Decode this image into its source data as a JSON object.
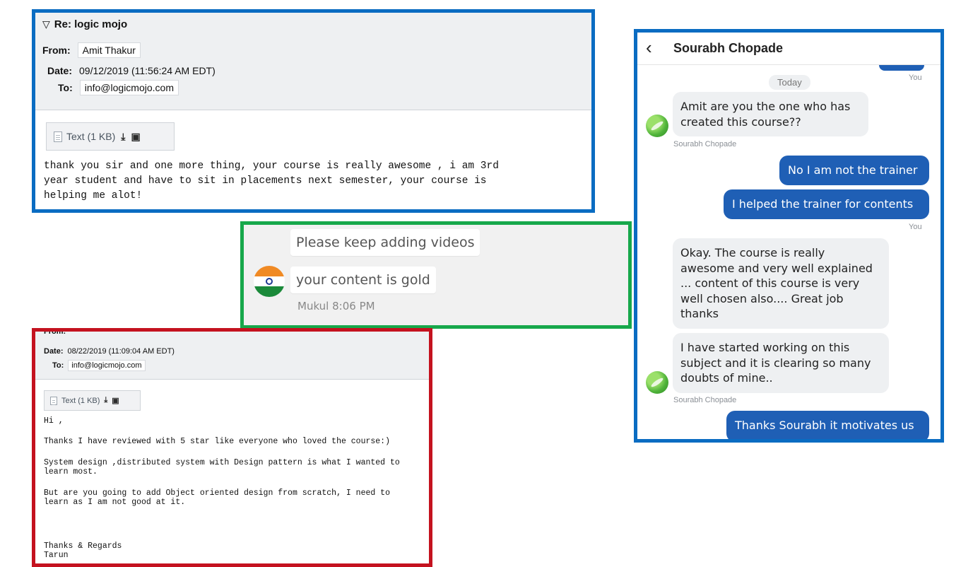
{
  "email1": {
    "subject": "Re: logic mojo",
    "from_label": "From:",
    "from_value": "Amit Thakur",
    "date_label": "Date:",
    "date_value": "09/12/2019 (11:56:24 AM EDT)",
    "to_label": "To:",
    "to_value": "info@logicmojo.com",
    "attachment": "Text (1 KB)",
    "body": "thank you sir and one more thing, your course is really awesome , i am 3rd\nyear student and have to sit in placements next semester, your course is\nhelping me alot!"
  },
  "chat2": {
    "msg1": "Please keep adding videos",
    "msg2": "your content is gold",
    "meta": "Mukul 8:06 PM"
  },
  "email2": {
    "from_cut": "From:",
    "date_label": "Date:",
    "date_value": "08/22/2019 (11:09:04 AM EDT)",
    "to_label": "To:",
    "to_value": "info@logicmojo.com",
    "attachment": "Text (1 KB)",
    "greeting": "Hi ,",
    "p1": "Thanks I have reviewed with 5 star like everyone who loved the course:)",
    "p2": "System design ,distributed system with Design pattern is what I wanted to\nlearn most.",
    "p3": "But are you going to add Object oriented design from scratch, I need to\nlearn as I am not good at it.",
    "sign": "Thanks & Regards\nTarun"
  },
  "chat3": {
    "contact": "Sourabh Chopade",
    "today": "Today",
    "you": "You",
    "sender": "Sourabh Chopade",
    "m1": "Amit are you the one who has created this course??",
    "m2": "No I am not the trainer",
    "m3": "I helped the trainer for contents",
    "m4": "Okay. The course is really awesome and very well explained ... content of this course is very well chosen also.... Great job thanks",
    "m5": "I have started working on this subject and it is clearing so many doubts of mine..",
    "m6": "Thanks Sourabh it motivates us"
  },
  "colors": {
    "blue_frame": "#0a6cc2",
    "green_frame": "#17a84b",
    "red_frame": "#c4121f",
    "outgoing_bubble": "#1f5fb5"
  }
}
